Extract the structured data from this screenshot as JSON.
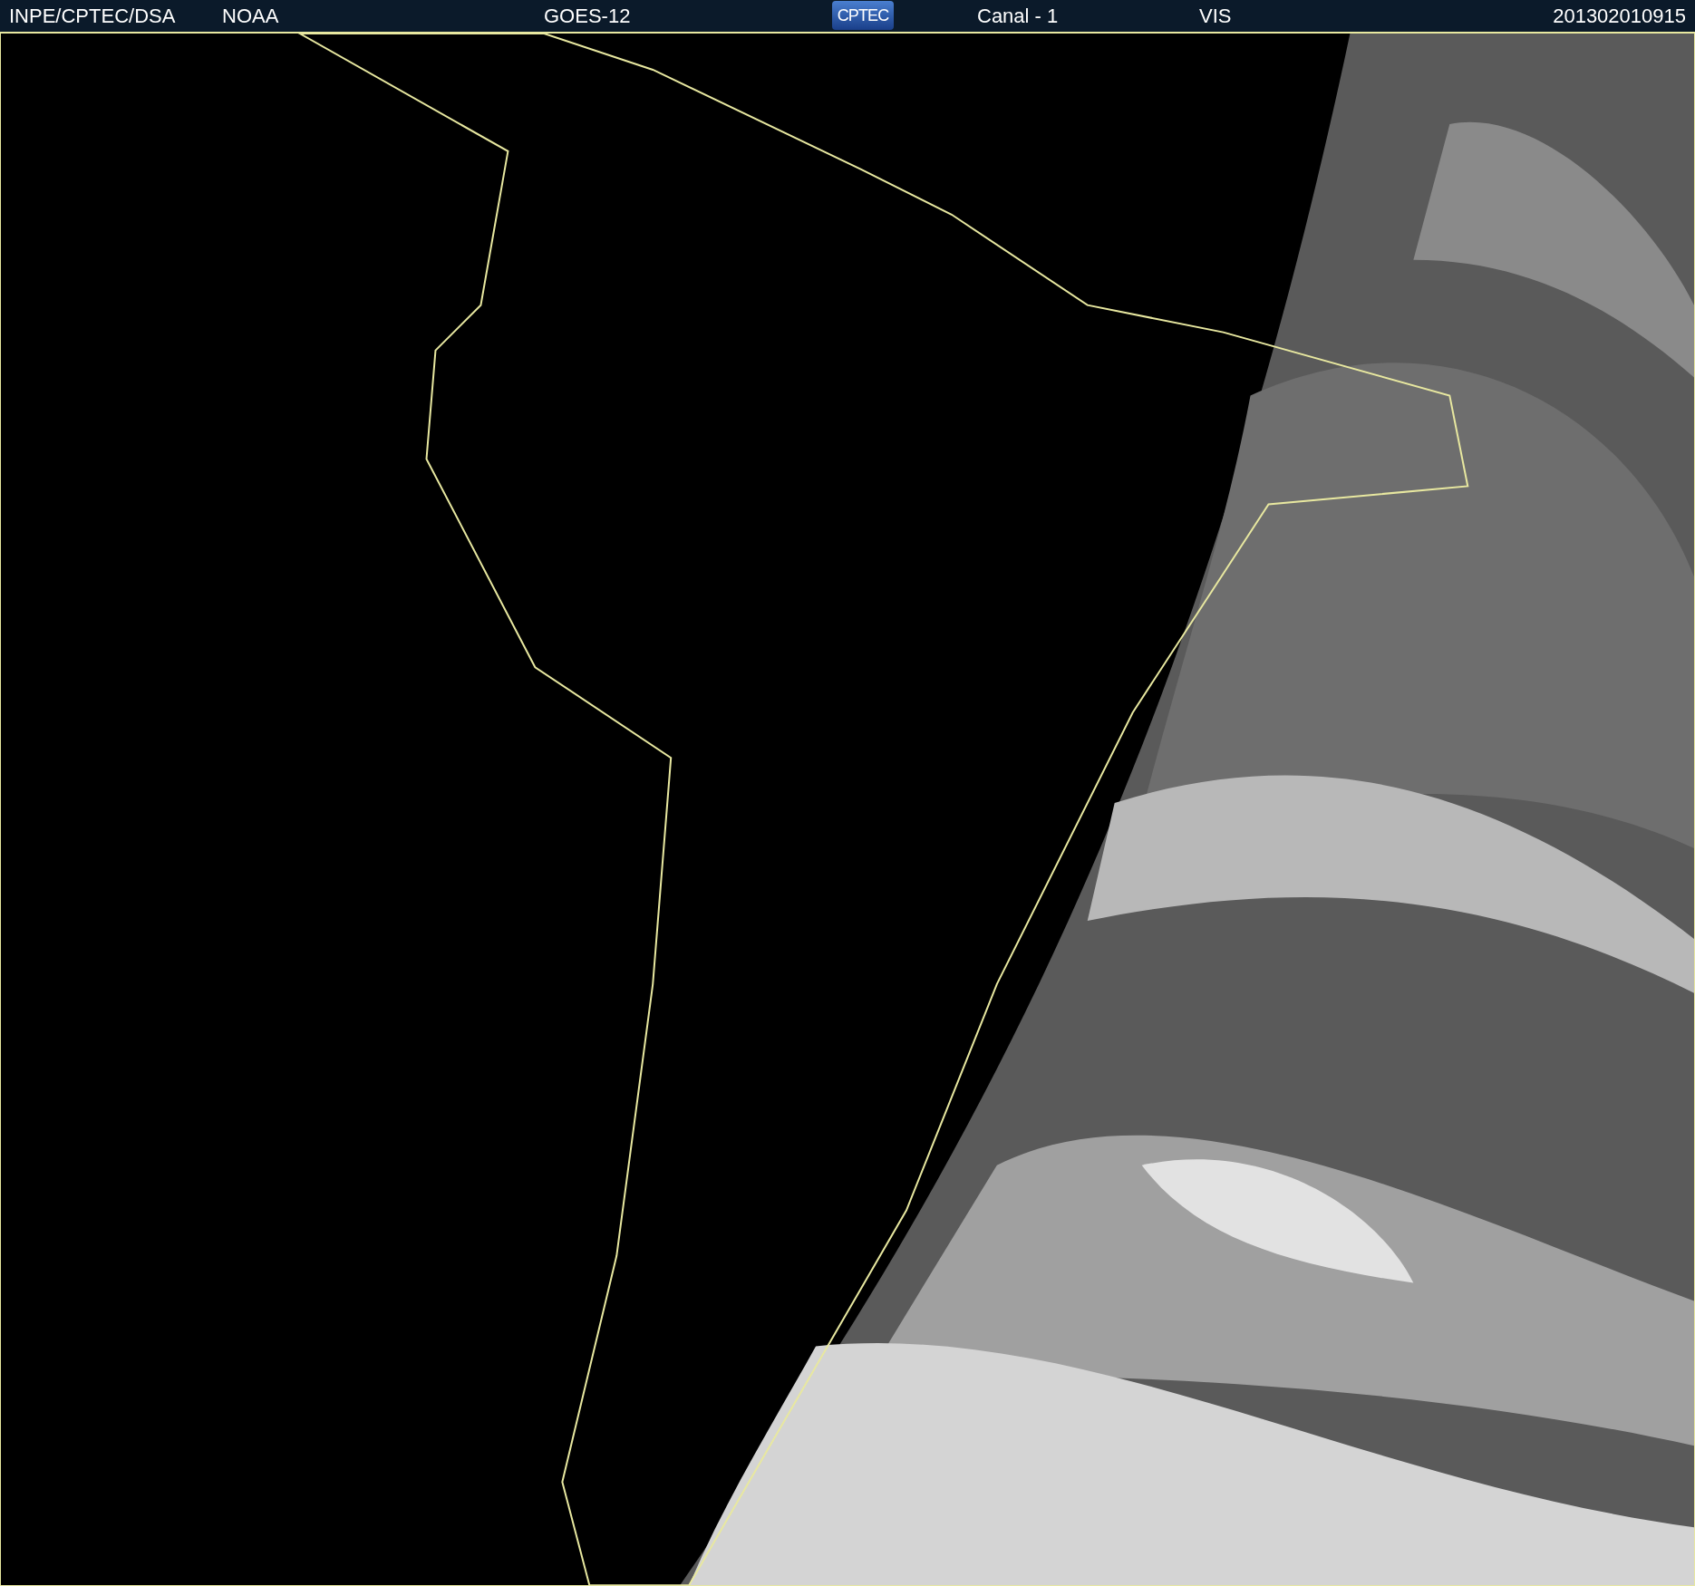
{
  "header": {
    "agency": "INPE/CPTEC/DSA",
    "source": "NOAA",
    "satellite": "GOES-12",
    "logo": "CPTEC",
    "channel": "Canal - 1",
    "band": "VIS",
    "timestamp": "201302010915"
  }
}
